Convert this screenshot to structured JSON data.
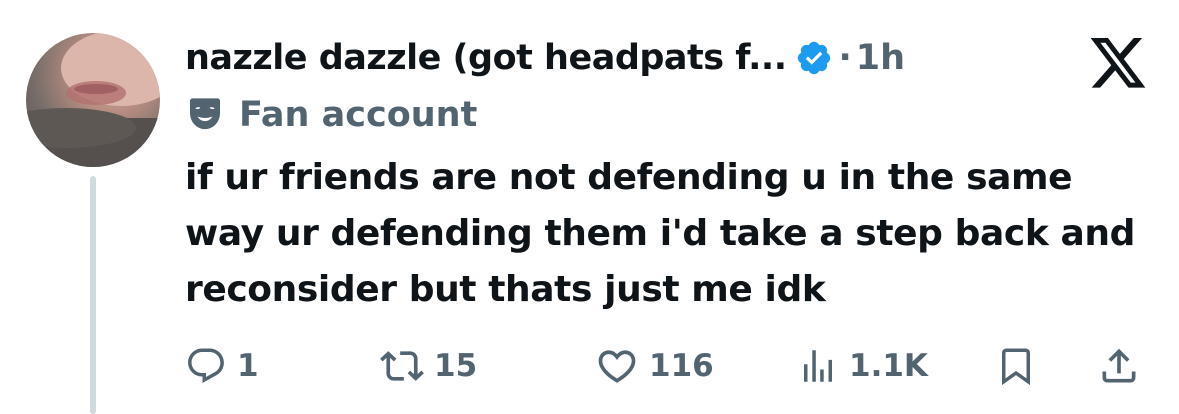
{
  "post": {
    "display_name": "nazzle dazzle (got headpats f...",
    "separator": "·",
    "timestamp": "1h",
    "label": "Fan account",
    "text": "if ur friends are not defending u in the same way ur defending them i'd take a step back and reconsider but thats just me idk"
  },
  "actions": {
    "replies": "1",
    "reposts": "15",
    "likes": "116",
    "views": "1.1K"
  },
  "icons": {
    "verified": "verified-badge-icon",
    "platform": "x-logo-icon",
    "label": "theater-mask-icon",
    "reply": "reply-icon",
    "repost": "repost-icon",
    "like": "heart-icon",
    "views": "views-icon",
    "bookmark": "bookmark-icon",
    "share": "share-icon"
  },
  "colors": {
    "text": "#0f1419",
    "secondary": "#536471",
    "verified": "#1d9bf0",
    "thread_line": "#cfd9de"
  }
}
